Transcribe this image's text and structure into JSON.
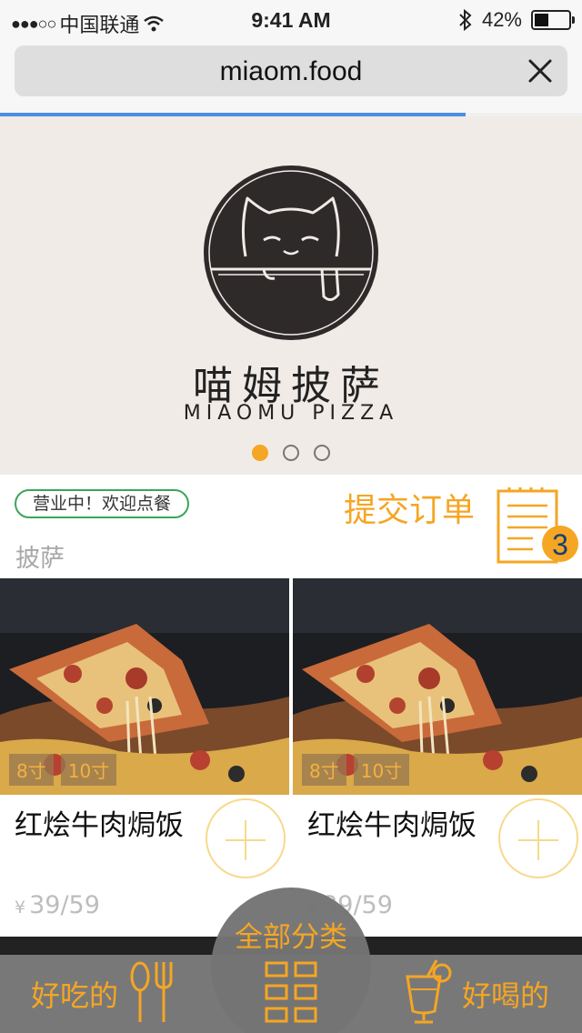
{
  "status_bar": {
    "carrier": "中国联通",
    "time": "9:41 AM",
    "battery": "42%",
    "battery_level": 0.42,
    "icons": [
      "signal-dots-icon",
      "wifi-icon",
      "bluetooth-icon",
      "battery-icon"
    ]
  },
  "browser": {
    "url": "miaom.food",
    "close_icon": "close-icon",
    "load_progress": 0.8,
    "accent": "#4a90e2"
  },
  "banner": {
    "brand_cn": "喵姆披萨",
    "brand_en": "MIAOMU PIZZA",
    "slide_count": 3,
    "active_slide": 0
  },
  "shop": {
    "status": "营业中！欢迎点餐",
    "submit_label": "提交订单",
    "cart_count": "3",
    "category": "披萨"
  },
  "products": [
    {
      "name": "红烩牛肉焗饭",
      "sizes": [
        "8寸",
        "10寸"
      ],
      "price": "39/59",
      "currency": "¥"
    },
    {
      "name": "红烩牛肉焗饭",
      "sizes": [
        "8寸",
        "10寸"
      ],
      "price": "39/59",
      "currency": "¥"
    }
  ],
  "bottom_nav": {
    "food_label": "好吃的",
    "center_label": "全部分类",
    "drink_label": "好喝的",
    "accent": "#f5a623"
  }
}
